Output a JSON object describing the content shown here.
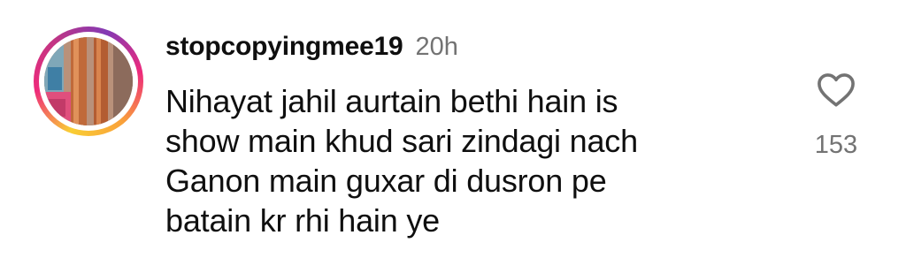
{
  "comment": {
    "username": "stopcopyingmee19",
    "timestamp": "20h",
    "text": "Nihayat jahil aurtain bethi hain is\nshow main khud sari zindagi nach\nGanon main guxar di dusron pe\nbatain kr rhi hain ye",
    "like_icon": "heart-outline-icon",
    "like_count": "153",
    "avatar_ring_colors": [
      "#f9ce34",
      "#ee2a7b",
      "#833ab4"
    ]
  }
}
